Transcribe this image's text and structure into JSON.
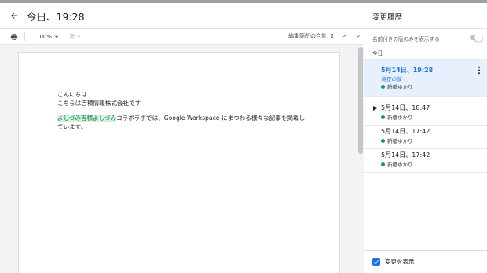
{
  "header": {
    "title": "今日、19:28"
  },
  "toolbar": {
    "zoom": "100%",
    "style_placeholder": "あ",
    "edit_count": "編集箇所の合計: 2"
  },
  "document": {
    "line1": "こんにちは",
    "line2": "こちらは吉積情報株式会社です",
    "line3_insert": "よしづみ吉積よしづみ",
    "line3_rest": "コラボラボでは、Google Workspace にまつわる様々な記事を掲載し",
    "line4": "ています。"
  },
  "panel": {
    "title": "変更履歴",
    "named_only_label": "名前付きの版のみを表示する",
    "section_today": "今日",
    "versions": [
      {
        "date": "5月14日、19:28",
        "subtitle": "現在の版",
        "author": "新橋ゆかり"
      },
      {
        "date": "5月14日、18:47",
        "author": "新橋ゆかり"
      },
      {
        "date": "5月14日、17:42",
        "author": "新橋ゆかり"
      },
      {
        "date": "5月14日、17:42",
        "author": "新橋ゆかり"
      }
    ],
    "show_changes_label": "変更を表示"
  },
  "colors": {
    "accent": "#1a73e8",
    "selected_bg": "#e8f0fe",
    "author_dot": "#0f9d58",
    "insertion": "#0b8043"
  },
  "icons": [
    "arrow-back-icon",
    "print-icon",
    "chevron-down-icon",
    "chevron-up-icon",
    "caret-right-icon",
    "more-vert-icon",
    "checkbox-checked-icon"
  ]
}
